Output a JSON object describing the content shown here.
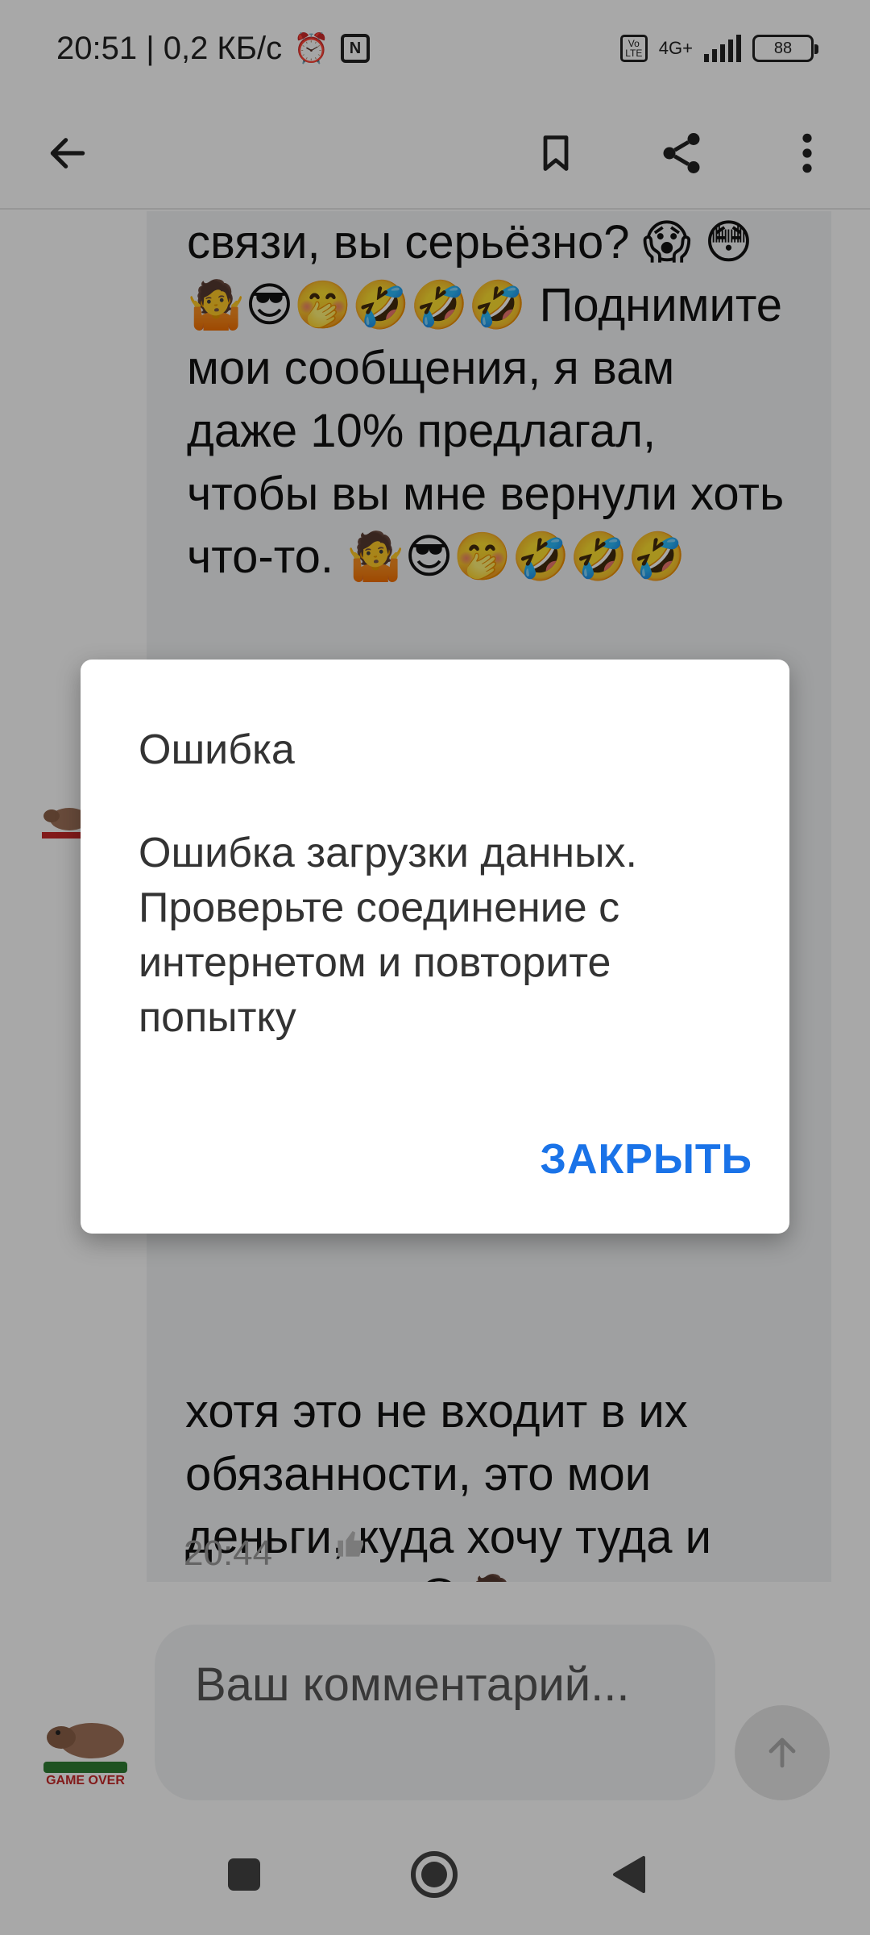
{
  "status_bar": {
    "time_speed": "20:51 | 0,2 КБ/с",
    "network_type": "4G+",
    "volte_label": "Vo\nLTE",
    "battery": "88",
    "nfc_glyph": "N",
    "alarm_glyph": "⏰"
  },
  "toolbar": {
    "back_icon": "arrow-left",
    "bookmark_icon": "bookmark",
    "share_icon": "share",
    "more_icon": "more-vertical"
  },
  "messages": [
    {
      "text": "связи, вы серьёзно? 😱 😳🤷😎🤭🤣🤣🤣 Поднимите мои сообщения, я вам даже 10% предлагал, чтобы вы мне вернули хоть что-то. 🤷😎🤭🤣🤣🤣"
    },
    {
      "text": "хотя это не входит в их обязанности, это мои деньги, куда хочу туда и перевожу. 😎🤷",
      "time": "20:44"
    }
  ],
  "comment_input": {
    "placeholder": "Ваш комментарий..."
  },
  "dialog": {
    "title": "Ошибка",
    "message": "Ошибка загрузки данных. Проверьте соединение с интернетом и повторите попытку",
    "close_label": "ЗАКРЫТЬ"
  },
  "colors": {
    "accent": "#1a73e8",
    "bubble": "#f2f3f5",
    "scrim": "rgba(0,0,0,0.34)"
  }
}
